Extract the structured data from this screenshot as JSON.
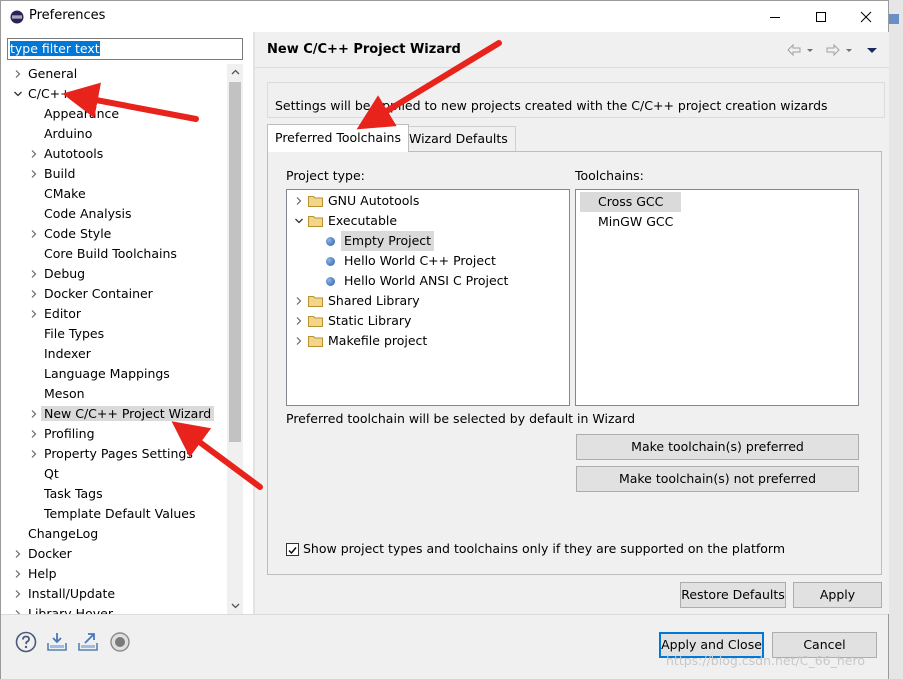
{
  "window": {
    "title": "Preferences"
  },
  "filter": {
    "value": "type filter text"
  },
  "tree": [
    {
      "label": "General",
      "indent": 0,
      "expander": "closed"
    },
    {
      "label": "C/C++",
      "indent": 0,
      "expander": "open"
    },
    {
      "label": "Appearance",
      "indent": 1,
      "expander": "none"
    },
    {
      "label": "Arduino",
      "indent": 1,
      "expander": "none"
    },
    {
      "label": "Autotools",
      "indent": 1,
      "expander": "closed"
    },
    {
      "label": "Build",
      "indent": 1,
      "expander": "closed"
    },
    {
      "label": "CMake",
      "indent": 1,
      "expander": "none"
    },
    {
      "label": "Code Analysis",
      "indent": 1,
      "expander": "none"
    },
    {
      "label": "Code Style",
      "indent": 1,
      "expander": "closed"
    },
    {
      "label": "Core Build Toolchains",
      "indent": 1,
      "expander": "none"
    },
    {
      "label": "Debug",
      "indent": 1,
      "expander": "closed"
    },
    {
      "label": "Docker Container",
      "indent": 1,
      "expander": "closed"
    },
    {
      "label": "Editor",
      "indent": 1,
      "expander": "closed"
    },
    {
      "label": "File Types",
      "indent": 1,
      "expander": "none"
    },
    {
      "label": "Indexer",
      "indent": 1,
      "expander": "none"
    },
    {
      "label": "Language Mappings",
      "indent": 1,
      "expander": "none"
    },
    {
      "label": "Meson",
      "indent": 1,
      "expander": "none"
    },
    {
      "label": "New C/C++ Project Wizard",
      "indent": 1,
      "expander": "closed",
      "selected": true
    },
    {
      "label": "Profiling",
      "indent": 1,
      "expander": "closed"
    },
    {
      "label": "Property Pages Settings",
      "indent": 1,
      "expander": "closed"
    },
    {
      "label": "Qt",
      "indent": 1,
      "expander": "none"
    },
    {
      "label": "Task Tags",
      "indent": 1,
      "expander": "none"
    },
    {
      "label": "Template Default Values",
      "indent": 1,
      "expander": "none"
    },
    {
      "label": "ChangeLog",
      "indent": 0,
      "expander": "none"
    },
    {
      "label": "Docker",
      "indent": 0,
      "expander": "closed"
    },
    {
      "label": "Help",
      "indent": 0,
      "expander": "closed"
    },
    {
      "label": "Install/Update",
      "indent": 0,
      "expander": "closed"
    },
    {
      "label": "Library Hover",
      "indent": 0,
      "expander": "closed",
      "partial": true
    }
  ],
  "page": {
    "title": "New C/C++ Project Wizard",
    "description": "Settings will be applied to new projects created with the C/C++ project creation wizards",
    "tabs": [
      {
        "label": "Preferred Toolchains",
        "active": true
      },
      {
        "label": "Wizard Defaults",
        "active": false
      }
    ],
    "project_type_label": "Project type:",
    "toolchains_label": "Toolchains:",
    "project_types": [
      {
        "label": "GNU Autotools",
        "kind": "folder",
        "indent": 0,
        "expander": "closed"
      },
      {
        "label": "Executable",
        "kind": "folder",
        "indent": 0,
        "expander": "open"
      },
      {
        "label": "Empty Project",
        "kind": "item",
        "indent": 1,
        "expander": "none",
        "selected": true
      },
      {
        "label": "Hello World C++ Project",
        "kind": "item",
        "indent": 1,
        "expander": "none"
      },
      {
        "label": "Hello World ANSI C Project",
        "kind": "item",
        "indent": 1,
        "expander": "none"
      },
      {
        "label": "Shared Library",
        "kind": "folder",
        "indent": 0,
        "expander": "closed"
      },
      {
        "label": "Static Library",
        "kind": "folder",
        "indent": 0,
        "expander": "closed"
      },
      {
        "label": "Makefile project",
        "kind": "folder",
        "indent": 0,
        "expander": "closed"
      }
    ],
    "toolchains": [
      {
        "label": "Cross GCC",
        "selected": true
      },
      {
        "label": "MinGW GCC",
        "selected": false
      }
    ],
    "preferred_note": "Preferred toolchain will be selected by default in Wizard",
    "make_preferred_label": "Make toolchain(s) preferred",
    "make_not_preferred_label": "Make toolchain(s) not preferred",
    "show_supported_label": "Show project types and toolchains only if they are supported on the platform",
    "show_supported_checked": true,
    "restore_defaults_label": "Restore Defaults",
    "apply_label": "Apply"
  },
  "footer": {
    "apply_close_label": "Apply and Close",
    "cancel_label": "Cancel",
    "watermark": "https://blog.csdn.net/C_66_hero"
  },
  "icons": [
    "eclipse-icon",
    "minimize-icon",
    "maximize-icon",
    "close-icon",
    "back-arrow-icon",
    "forward-arrow-icon",
    "view-menu-icon",
    "help-icon",
    "import-icon",
    "export-icon",
    "record-icon"
  ],
  "colors": {
    "selection": "#0078d7",
    "annotation_arrow": "#e8231c",
    "item_bullet": "#3b6fb6",
    "folder": "#e8c56c"
  }
}
